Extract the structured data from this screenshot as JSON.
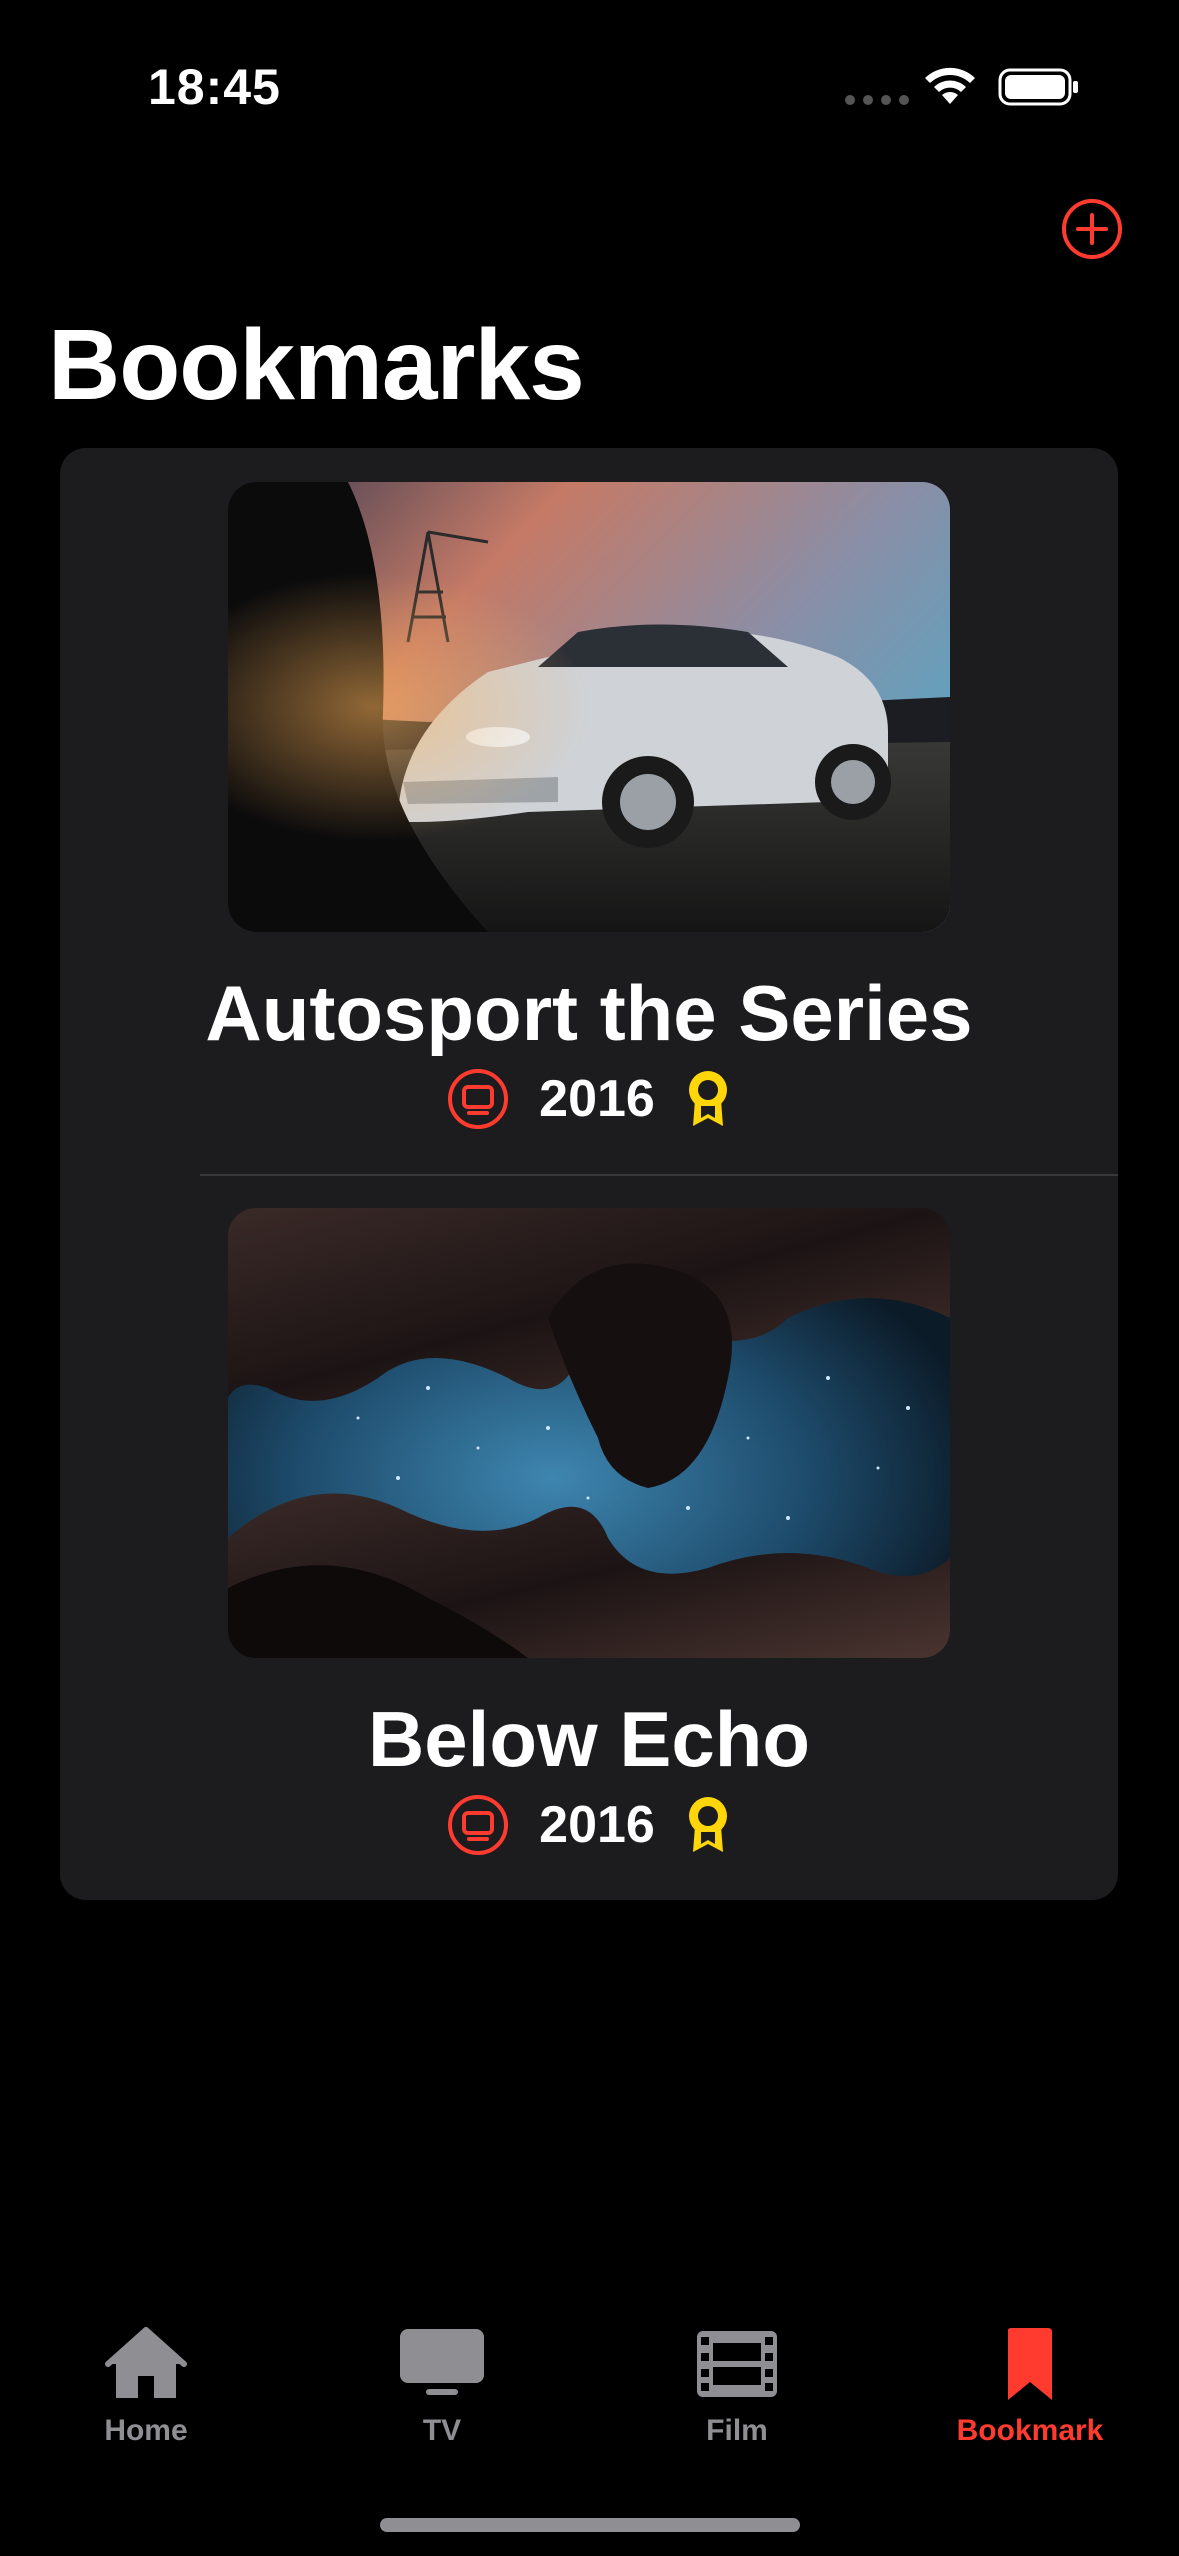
{
  "status_bar": {
    "time": "18:45"
  },
  "header": {
    "title": "Bookmarks"
  },
  "colors": {
    "accent": "#ff3b30",
    "award": "#ffd60a",
    "card_bg": "#1c1c1e",
    "inactive": "#8e8e93"
  },
  "bookmarks": [
    {
      "title": "Autosport the Series",
      "year": "2016",
      "type_icon": "tv-icon",
      "award_icon": "award-ribbon-icon"
    },
    {
      "title": "Below Echo",
      "year": "2016",
      "type_icon": "tv-icon",
      "award_icon": "award-ribbon-icon"
    }
  ],
  "tabs": [
    {
      "label": "Home",
      "icon": "house-icon",
      "active": false
    },
    {
      "label": "TV",
      "icon": "tv-icon",
      "active": false
    },
    {
      "label": "Film",
      "icon": "film-icon",
      "active": false
    },
    {
      "label": "Bookmark",
      "icon": "bookmark-icon",
      "active": true
    }
  ]
}
